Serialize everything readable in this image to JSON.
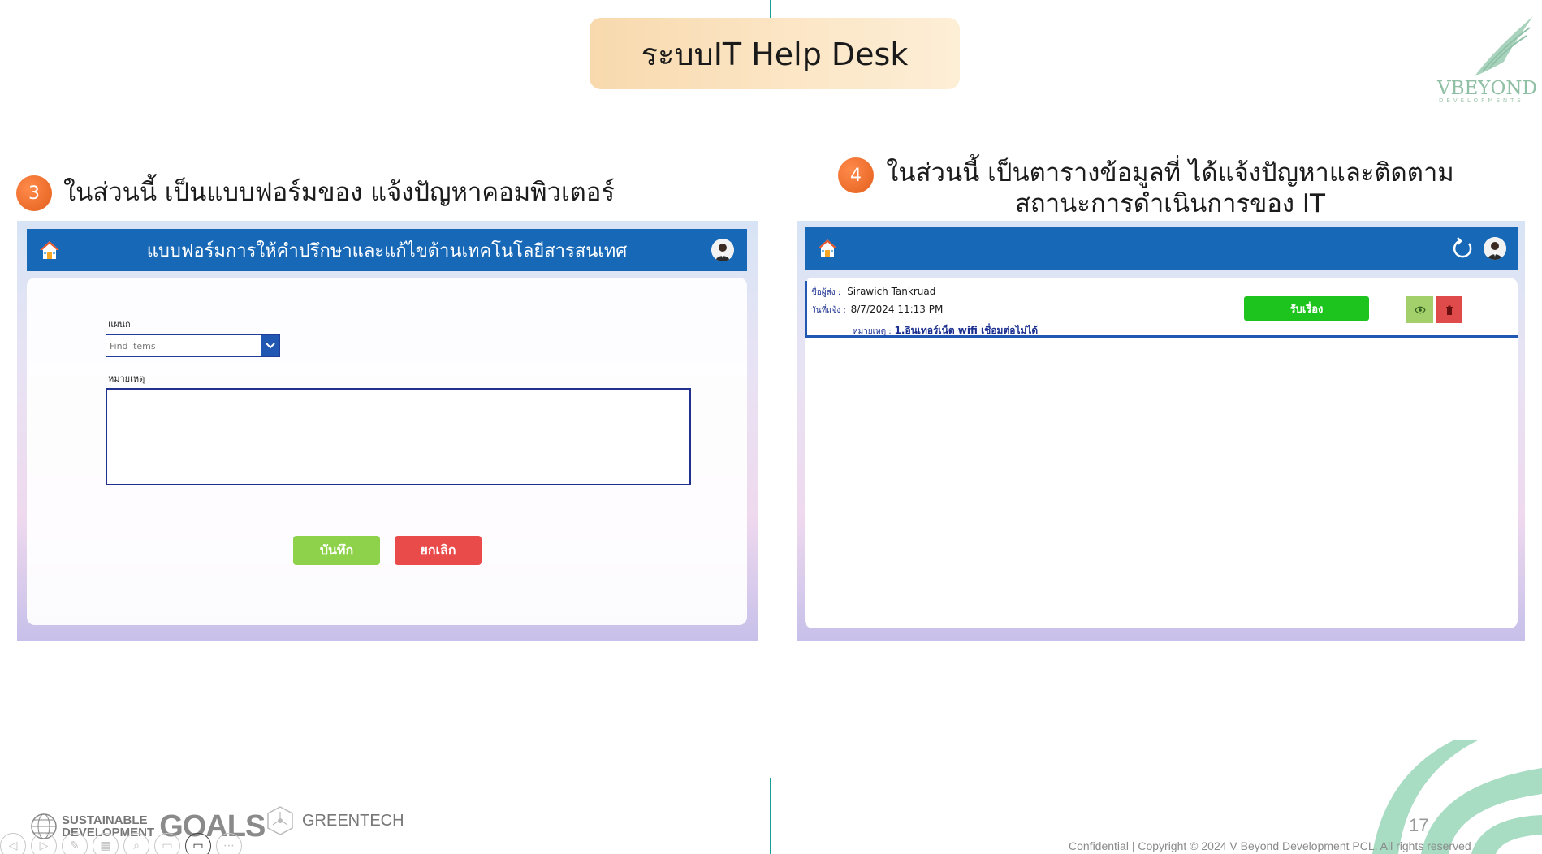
{
  "slide": {
    "title": "ระบบIT Help Desk",
    "page_number": "17",
    "copyright": "Confidential  |  Copyright ©  2024 V Beyond Development PCL. All rights reserved"
  },
  "logo": {
    "word": "VBEYOND",
    "sub": "DEVELOPMENTS"
  },
  "steps": [
    {
      "number": "3",
      "text": "ในส่วนนี้ เป็นแบบฟอร์มของ แจ้งปัญหาคอมพิวเตอร์"
    },
    {
      "number": "4",
      "text_line1": "ในส่วนนี้ เป็นตารางข้อมูลที่ ได้แจ้งปัญหาและติดตาม",
      "text_line2": "สถานะการดำเนินการของ IT"
    }
  ],
  "form_app": {
    "header_title": "แบบฟอร์มการให้คำปรึกษาและแก้ไขด้านเทคโนโลยีสารสนเทศ",
    "department_label": "แผนก",
    "department_placeholder": "Find items",
    "note_label": "หมายเหตุ",
    "note_value": "",
    "save_label": "บันทึก",
    "cancel_label": "ยกเลิก"
  },
  "list_app": {
    "tickets": [
      {
        "sender_label": "ชื่อผู้ส่ง :",
        "sender": "Sirawich Tankruad",
        "date_label": "วันที่แจ้ง :",
        "date": "8/7/2024 11:13 PM",
        "note_label": "หมายเหตุ :",
        "note": "1.อินเทอร์เน็ต wifi เชื่อมต่อไม่ได้",
        "accept_label": "รับเรื่อง"
      }
    ]
  },
  "footer": {
    "sdg_line1": "SUSTAINABLE",
    "sdg_line2": "DEVELOPMENT",
    "sdg_goals": "GOALS",
    "greentech": "GREENTECH"
  },
  "colors": {
    "app_header": "#1769b8",
    "accept_green": "#1ec41e",
    "save_green": "#8ed24b",
    "cancel_red": "#e94a4a",
    "step_orange": "#e8621f"
  }
}
